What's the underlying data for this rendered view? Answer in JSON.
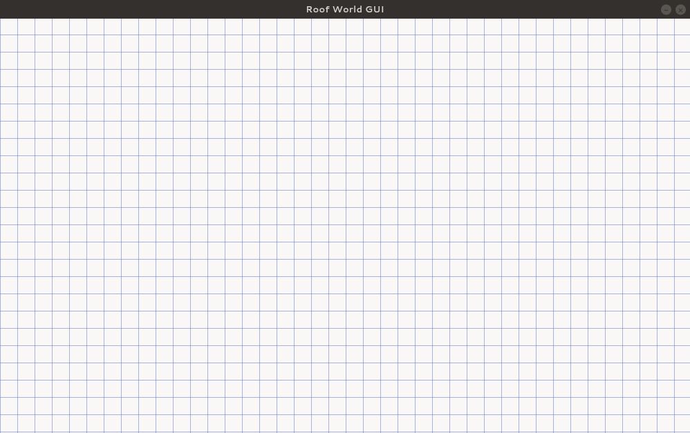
{
  "window": {
    "title": "Roof World GUI"
  },
  "controls": {
    "minimize": "minimize",
    "close": "close"
  },
  "canvas": {
    "grid_spacing_px": 25,
    "grid_color": "#8ca0d8",
    "background": "#faf8f7"
  }
}
